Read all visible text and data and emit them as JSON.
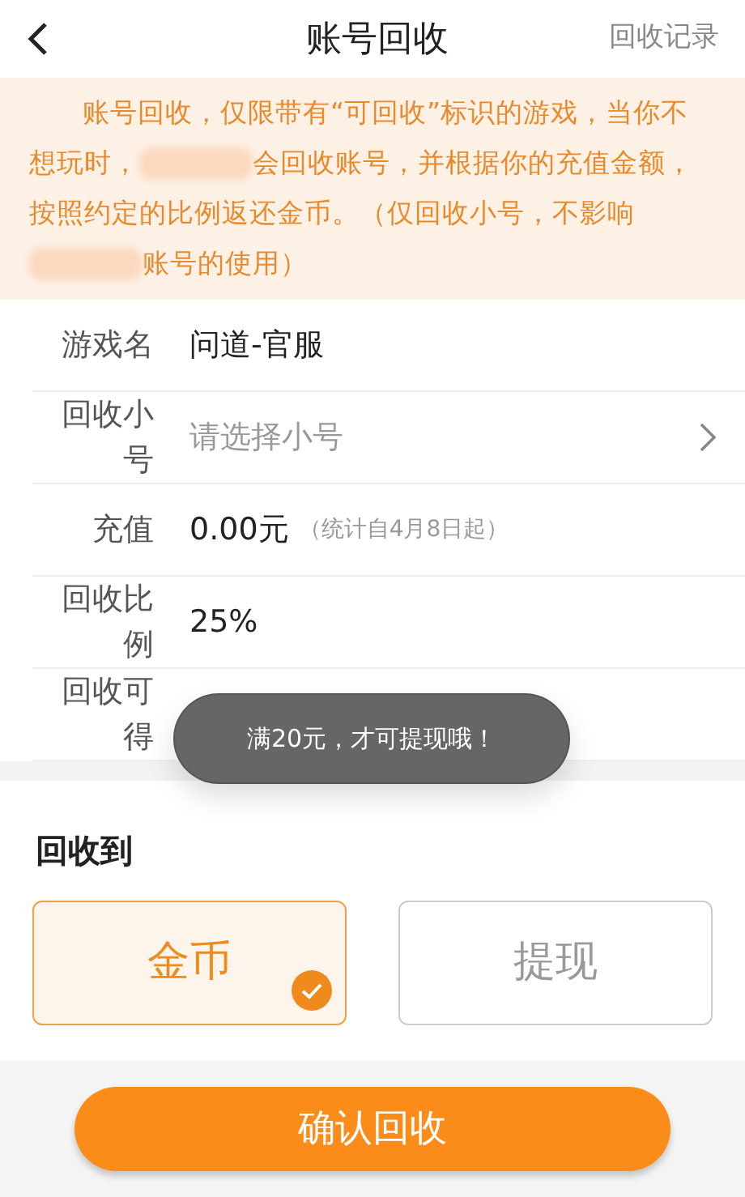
{
  "header": {
    "title": "账号回收",
    "action": "回收记录"
  },
  "notice": [
    {
      "kind": "text",
      "text": "账号回收，仅限带有“可回收”标识的游戏，当你不想玩时，"
    },
    {
      "kind": "redacted"
    },
    {
      "kind": "text",
      "text": "会回收账号，并根据你的充值金额，按照约定的比例返还金币。（仅回收小号，不影响"
    },
    {
      "kind": "redacted"
    },
    {
      "kind": "text",
      "text": "账号的使用）"
    }
  ],
  "form": [
    {
      "kind": "value",
      "label": "游戏名",
      "value": "问道-官服"
    },
    {
      "kind": "picker",
      "label": "回收小号",
      "placeholder": "请选择小号"
    },
    {
      "kind": "value",
      "label": "充值",
      "value": "0.00元",
      "note": "（统计自4月8日起）"
    },
    {
      "kind": "value",
      "label": "回收比例",
      "value": "25%"
    },
    {
      "kind": "value",
      "label": "回收可得"
    }
  ],
  "recycle_to": {
    "title": "回收到",
    "options": [
      {
        "label": "金币",
        "selected": true
      },
      {
        "label": "提现",
        "selected": false
      }
    ]
  },
  "toast": "满20元，才可提现哦！",
  "confirm_button": "确认回收"
}
